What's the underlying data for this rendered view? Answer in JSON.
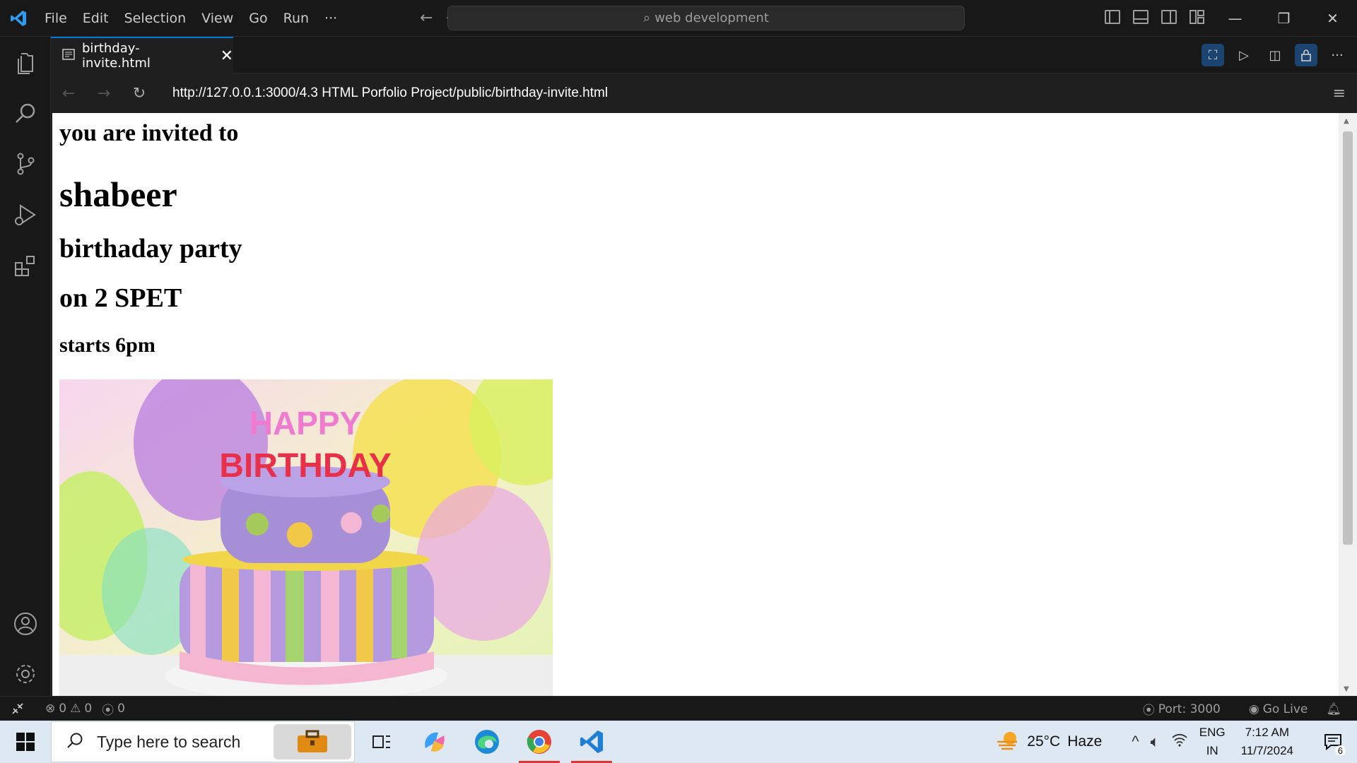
{
  "titlebar": {
    "menu": [
      "File",
      "Edit",
      "Selection",
      "View",
      "Go",
      "Run",
      "···"
    ],
    "search_text": "web development"
  },
  "tab": {
    "title": "birthday-invite.html",
    "close": "✕"
  },
  "browser": {
    "url": "http://127.0.0.1:3000/4.3 HTML Porfolio Project/public/birthday-invite.html"
  },
  "page": {
    "line1": "you are invited to",
    "line2": "shabeer",
    "line3": "birthaday party",
    "line4": "on 2 SPET",
    "line5": "starts 6pm",
    "image_text": "HAPPY BIRTHDAY"
  },
  "statusbar": {
    "errors": "0",
    "warnings": "0",
    "ports": "0",
    "port": "Port: 3000",
    "golive": "Go Live"
  },
  "taskbar": {
    "search_placeholder": "Type here to search",
    "weather_temp": "25°C",
    "weather_desc": "Haze",
    "lang1": "ENG",
    "lang2": "IN",
    "time": "7:12 AM",
    "date": "11/7/2024",
    "notifications": "6"
  },
  "colors": {
    "accent": "#0078d4",
    "editor_bg": "#1f1f1f",
    "chrome_bg": "#181818"
  }
}
